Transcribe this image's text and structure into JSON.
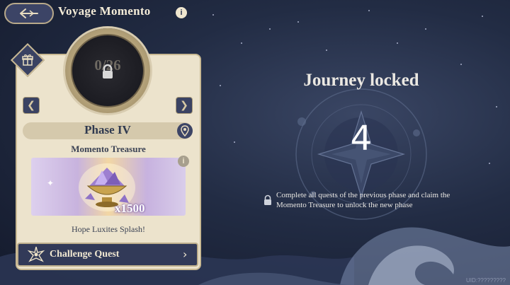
{
  "header": {
    "title": "Voyage Momento",
    "info_glyph": "i"
  },
  "card": {
    "progress": {
      "current": "0",
      "total": "26",
      "text": "0/26"
    },
    "phase_label": "Phase IV",
    "prev_glyph": "❮",
    "next_glyph": "❯",
    "treasure_title": "Momento Treasure",
    "treasure_qty": "x1500",
    "treasure_name": "Hope Luxites Splash!",
    "challenge_label": "Challenge Quest",
    "challenge_chevron": "›"
  },
  "journey": {
    "title": "Journey locked",
    "phase_number": "4",
    "message": "Complete all quests of the previous phase and claim the Momento Treasure to unlock the new phase"
  },
  "uid": "UID:?????????",
  "icons": {
    "back": "back-arrow-icon",
    "info": "info-icon",
    "gift": "gift-icon",
    "lock": "lock-icon",
    "pin": "location-pin-icon",
    "challenge": "crown-star-icon",
    "emblem": "compass-emblem-icon"
  },
  "colors": {
    "card_bg": "#ece3cc",
    "dark_button": "#323a58",
    "gold_border": "#bdae8c",
    "sky": "#222c44"
  }
}
